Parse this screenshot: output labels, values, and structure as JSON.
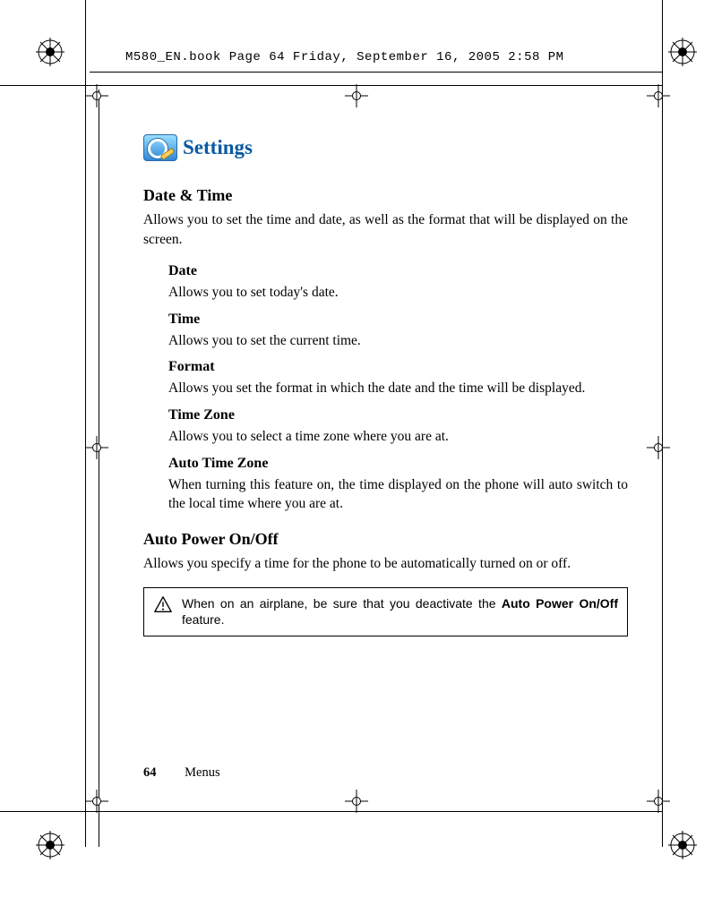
{
  "header": {
    "running_head": "M580_EN.book  Page 64  Friday, September 16, 2005  2:58 PM"
  },
  "page": {
    "title": "Settings",
    "sections": [
      {
        "heading": "Date & Time",
        "desc": "Allows you to set the time and date, as well as the format that will be displayed on the screen.",
        "subs": [
          {
            "title": " Date",
            "desc": "Allows you to set today's date."
          },
          {
            "title": "Time",
            "desc": "Allows you to set the current time."
          },
          {
            "title": "Format",
            "desc": "Allows you set the format in which the date and the time will be displayed."
          },
          {
            "title": "Time Zone",
            "desc": "Allows you to select a time zone where you are at."
          },
          {
            "title": "Auto Time Zone",
            "desc": "When turning this feature on, the time displayed on the phone will auto switch to the local time where you are at."
          }
        ]
      },
      {
        "heading": "Auto Power On/Off",
        "desc": "Allows you specify a time for the phone to be automatically turned on or off."
      }
    ],
    "note": {
      "pre": "When on an airplane, be sure that you deactivate the ",
      "bold": "Auto Power On/Off",
      "post": " feature."
    },
    "footer": {
      "page_number": "64",
      "section": "Menus"
    }
  }
}
